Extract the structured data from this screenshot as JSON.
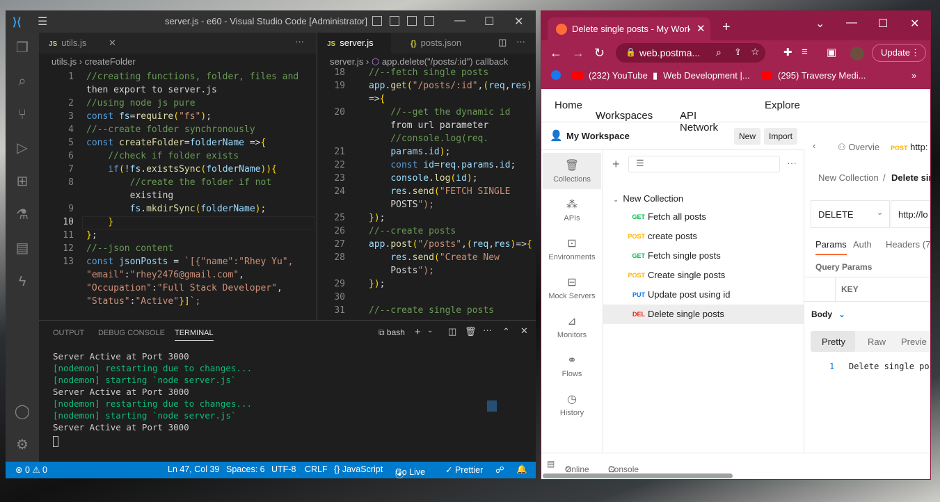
{
  "vscode": {
    "window_title": "server.js - e60 - Visual Studio Code [Administrator]",
    "left_editor": {
      "tab_label": "utils.js",
      "tab_badge": "JS",
      "breadcrumb": [
        "utils.js",
        "createFolder"
      ],
      "lines": [
        {
          "n": "1",
          "t": "//creating functions, folder, files and"
        },
        {
          "n": "",
          "t": "then export to server.js"
        },
        {
          "n": "2",
          "t": "//using node js pure"
        },
        {
          "n": "3",
          "t": "const fs=require(\"fs\");"
        },
        {
          "n": "4",
          "t": "//--create folder synchronously"
        },
        {
          "n": "5",
          "t": "const createFolder=folderName =>{"
        },
        {
          "n": "6",
          "t": "    //check if folder exists"
        },
        {
          "n": "7",
          "t": "    if(!fs.existsSync(folderName)){"
        },
        {
          "n": "8",
          "t": "        //create the folder if not"
        },
        {
          "n": "",
          "t": "        existing"
        },
        {
          "n": "9",
          "t": "        fs.mkdirSync(folderName);"
        },
        {
          "n": "10",
          "t": "    }"
        },
        {
          "n": "11",
          "t": "};"
        },
        {
          "n": "12",
          "t": "//--json content"
        },
        {
          "n": "13",
          "t": "const jsonPosts = `[{\"name\":\"Rhey Yu\","
        },
        {
          "n": "",
          "t": "\"email\":\"rhey2476@gmail.com\","
        },
        {
          "n": "",
          "t": "\"Occupation\":\"Full Stack Developer\","
        },
        {
          "n": "",
          "t": "\"Status\":\"Active\"}]`;"
        }
      ]
    },
    "right_editor": {
      "tabs": [
        {
          "badge": "JS",
          "label": "server.js"
        },
        {
          "badge": "{}",
          "label": "posts.json"
        }
      ],
      "breadcrumb": [
        "server.js",
        "app.delete(\"/posts/:id\") callback"
      ],
      "lines": [
        {
          "n": "18",
          "t": "//--fetch single posts"
        },
        {
          "n": "19",
          "t": "app.get(\"/posts/:id\",(req,res)"
        },
        {
          "n": "",
          "t": "=>{"
        },
        {
          "n": "20",
          "t": "    //--get the dynamic id"
        },
        {
          "n": "",
          "t": "    from url parameter"
        },
        {
          "n": "",
          "t": "    //console.log(req."
        },
        {
          "n": "21",
          "t": "    params.id);"
        },
        {
          "n": "22",
          "t": "    const id=req.params.id;"
        },
        {
          "n": "23",
          "t": "    console.log(id);"
        },
        {
          "n": "24",
          "t": "    res.send(\"FETCH SINGLE"
        },
        {
          "n": "",
          "t": "    POSTS\");"
        },
        {
          "n": "25",
          "t": "});"
        },
        {
          "n": "26",
          "t": "//--create posts"
        },
        {
          "n": "27",
          "t": "app.post(\"/posts\",(req,res)=>{"
        },
        {
          "n": "28",
          "t": "    res.send(\"Create New"
        },
        {
          "n": "",
          "t": "    Posts\");"
        },
        {
          "n": "29",
          "t": "});"
        },
        {
          "n": "30",
          "t": ""
        },
        {
          "n": "31",
          "t": "//--create single posts"
        }
      ]
    },
    "panel": {
      "tabs": [
        "OUTPUT",
        "DEBUG CONSOLE",
        "TERMINAL"
      ],
      "shell": "bash",
      "terminal": [
        {
          "c": "white",
          "t": "Server Active at Port 3000"
        },
        {
          "c": "green",
          "t": "[nodemon] restarting due to changes..."
        },
        {
          "c": "green",
          "t": "[nodemon] starting `node server.js`"
        },
        {
          "c": "white",
          "t": "Server Active at Port 3000"
        },
        {
          "c": "green",
          "t": "[nodemon] restarting due to changes..."
        },
        {
          "c": "green",
          "t": "[nodemon] starting `node server.js`"
        },
        {
          "c": "white",
          "t": "Server Active at Port 3000"
        }
      ]
    },
    "status": {
      "problems": "⊗ 0 ⚠ 0",
      "position": "Ln 47, Col 39",
      "spaces": "Spaces: 6",
      "encoding": "UTF-8",
      "eol": "CRLF",
      "language": "{} JavaScript",
      "golive": "Go Live",
      "prettier": "✓ Prettier"
    },
    "colors": {
      "statusbar": "#007acc",
      "editor_bg": "#1e1e1e"
    }
  },
  "chrome": {
    "tab_title": "Delete single posts - My Workspace",
    "url": "web.postma...",
    "update_label": "Update",
    "bookmarks": [
      "(232) YouTube",
      "Web Development |...",
      "(295) Traversy Medi..."
    ],
    "brand_color": "#8f1a43"
  },
  "postman": {
    "nav": [
      "Home",
      "Workspaces",
      "API Network",
      "Explore"
    ],
    "workspace_name": "My Workspace",
    "new_label": "New",
    "import_label": "Import",
    "sidebar": [
      "Collections",
      "APIs",
      "Environments",
      "Mock Servers",
      "Monitors",
      "Flows",
      "History"
    ],
    "collection_name": "New Collection",
    "requests": [
      {
        "method": "GET",
        "name": "Fetch all posts"
      },
      {
        "method": "POST",
        "name": "create posts"
      },
      {
        "method": "GET",
        "name": "Fetch single posts"
      },
      {
        "method": "POST",
        "name": "Create single posts"
      },
      {
        "method": "PUT",
        "name": "Update post using id"
      },
      {
        "method": "DEL",
        "name": "Delete single posts"
      }
    ],
    "main": {
      "overview_tab": "Overvie",
      "post_tab_method": "POST",
      "post_tab_url": "http:",
      "breadcrumb_parent": "New Collection",
      "breadcrumb_sep": "/",
      "breadcrumb_current": "Delete sin",
      "method": "DELETE",
      "url": "http://lo",
      "req_tabs": [
        "Params",
        "Auth",
        "Headers (7"
      ],
      "query_params": "Query Params",
      "key_header": "KEY",
      "body_label": "Body",
      "resp_tabs": [
        "Pretty",
        "Raw",
        "Previe"
      ],
      "resp_line_no": "1",
      "resp_text": "Delete single po"
    },
    "footer": [
      "Online",
      "Console"
    ]
  }
}
